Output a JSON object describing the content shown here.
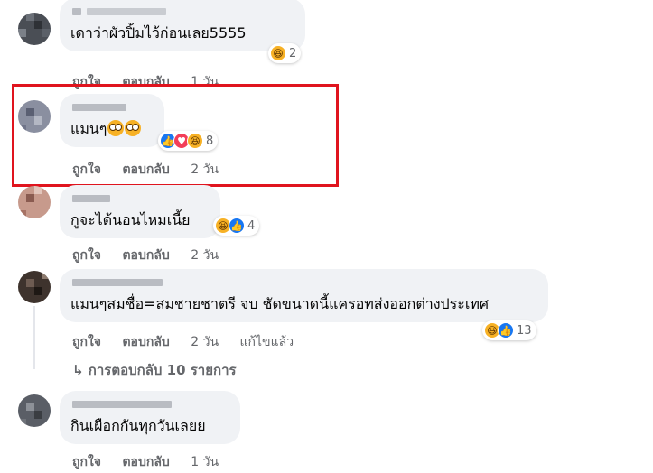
{
  "comments": [
    {
      "text": "เดาว่าผัวปิ้มไว้ก่อนเลย5555",
      "reactions_count": "2",
      "actions": {
        "like": "ถูกใจ",
        "reply": "ตอบกลับ",
        "time": "1 วัน"
      }
    },
    {
      "text": "แมนๆ",
      "reactions_count": "8",
      "actions": {
        "like": "ถูกใจ",
        "reply": "ตอบกลับ",
        "time": "2 วัน"
      }
    },
    {
      "text": "กูจะได้นอนไหมเนี้ย",
      "reactions_count": "4",
      "actions": {
        "like": "ถูกใจ",
        "reply": "ตอบกลับ",
        "time": "2 วัน"
      }
    },
    {
      "text": "แมนๆสมชื่อ=สมชายชาตรี จบ ชัดขนาดนี้แครอทส่งออกต่างประเทศ",
      "reactions_count": "13",
      "actions": {
        "like": "ถูกใจ",
        "reply": "ตอบกลับ",
        "time": "2 วัน",
        "edited": "แก้ไขแล้ว"
      }
    },
    {
      "text": "กินเผือกกันทุกวันเลยย",
      "actions": {
        "like": "ถูกใจ",
        "reply": "ตอบกลับ",
        "time": "1 วัน"
      }
    }
  ],
  "replies_link": "การตอบกลับ 10 รายการ",
  "colors": {
    "bubble": "#f0f2f5",
    "muted": "#65676b",
    "highlight": "#e0141e",
    "like": "#1877f2",
    "haha": "#f7b125",
    "love": "#f33e58"
  }
}
